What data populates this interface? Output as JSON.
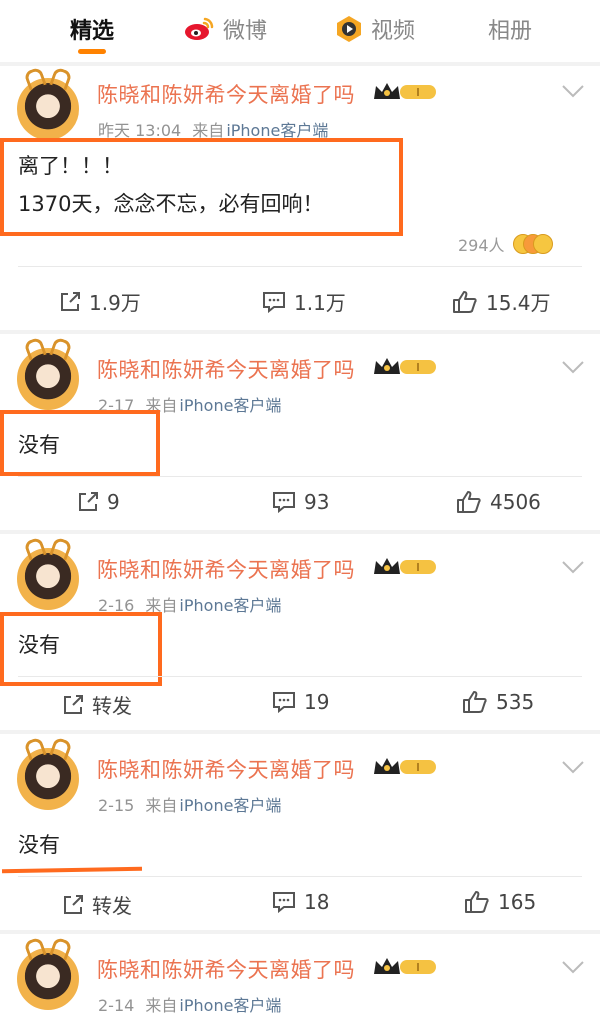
{
  "tabs": [
    {
      "label": "精选",
      "active": true
    },
    {
      "label": "微博",
      "active": false
    },
    {
      "label": "视频",
      "active": false
    },
    {
      "label": "相册",
      "active": false
    }
  ],
  "user": {
    "name": "陈晓和陈妍希今天离婚了吗",
    "badge": "I"
  },
  "source_prefix": "来自",
  "source_client": "iPhone客户端",
  "posts": [
    {
      "time": "昨天 13:04",
      "lines": [
        "离了！！！",
        "1370天，念念不忘，必有回响！"
      ],
      "reaction_count": "294人",
      "repost": "1.9万",
      "comments": "1.1万",
      "likes": "15.4万"
    },
    {
      "time": "2-17",
      "lines": [
        "没有"
      ],
      "repost": "9",
      "comments": "93",
      "likes": "4506"
    },
    {
      "time": "2-16",
      "lines": [
        "没有"
      ],
      "repost": "转发",
      "comments": "19",
      "likes": "535"
    },
    {
      "time": "2-15",
      "lines": [
        "没有"
      ],
      "repost": "转发",
      "comments": "18",
      "likes": "165"
    },
    {
      "time": "2-14",
      "lines": []
    }
  ],
  "colors": {
    "accent": "#ff8200",
    "username": "#eb7350",
    "highlight": "#ff6a1e",
    "client_link": "#5d7895"
  }
}
